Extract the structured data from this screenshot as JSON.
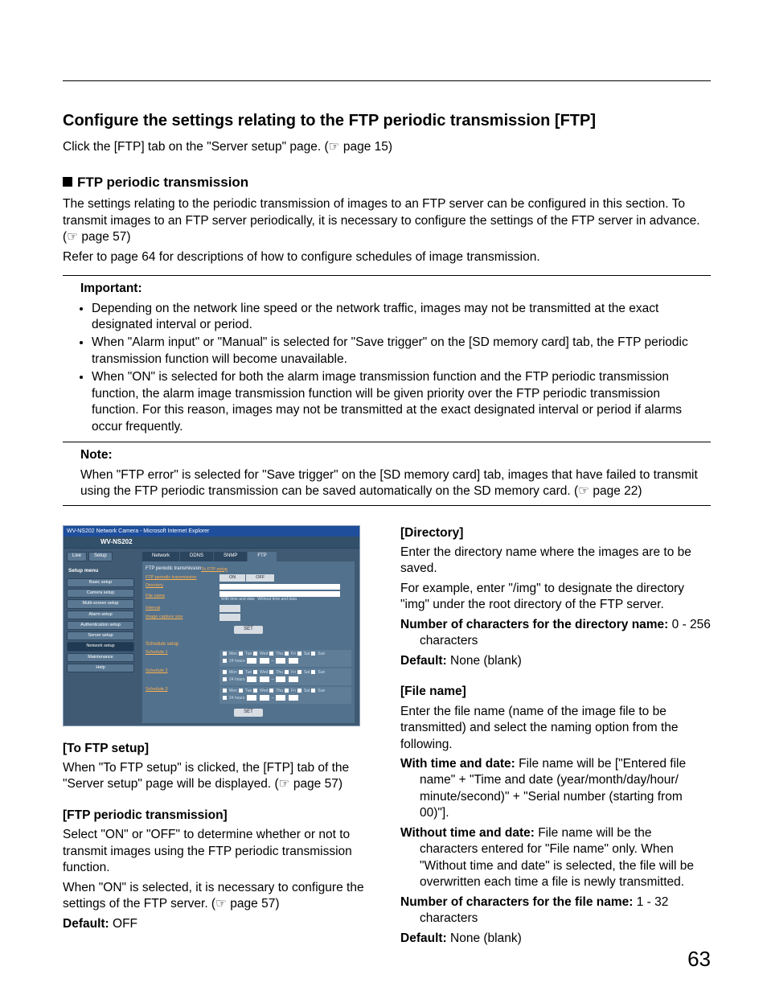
{
  "page_number": "63",
  "h1": "Configure the settings relating to the FTP periodic transmission [FTP]",
  "intro": "Click the [FTP] tab on the \"Server setup\" page. (☞ page 15)",
  "sub1": "FTP periodic transmission",
  "sub1_p1": "The settings relating to the periodic transmission of images to an FTP server can be configured in this section. To transmit images to an FTP server periodically, it is necessary to configure the settings of the FTP server in advance. (☞ page 57)",
  "sub1_p2": "Refer to page 64 for descriptions of how to configure schedules of image transmission.",
  "important": {
    "title": "Important:",
    "items": [
      "Depending on the network line speed or the network traffic, images may not be transmitted at the exact designated interval or period.",
      "When \"Alarm input\" or \"Manual\" is selected for \"Save trigger\" on the [SD memory card] tab, the FTP periodic transmission function will become unavailable.",
      "When \"ON\" is selected for both the alarm image transmission function and the FTP periodic transmission function, the alarm image transmission function will be given priority over the FTP periodic transmission function. For this reason, images may not be transmitted at the exact designated interval or period if alarms occur frequently."
    ]
  },
  "note": {
    "title": "Note:",
    "text": "When \"FTP error\" is selected for \"Save trigger\" on the [SD memory card] tab, images that have failed to transmit using the FTP periodic transmission can be saved automatically on the SD memory card. (☞ page 22)"
  },
  "screenshot": {
    "window_title": "WV-NS202 Network Camera - Microsoft Internet Explorer",
    "model": "WV-NS202",
    "top_tabs": {
      "live": "Live",
      "setup": "Setup"
    },
    "side_menu_title": "Setup menu",
    "side_menu": [
      "Basic setup",
      "Camera setup",
      "Multi-screen setup",
      "Alarm setup",
      "Authentication setup",
      "Server setup",
      "Network setup",
      "Maintenance",
      "Help"
    ],
    "main_tabs": [
      "Network",
      "DDNS",
      "SNMP",
      "FTP"
    ],
    "section_title": "FTP periodic transmission",
    "to_ftp_link": "To FTP setup",
    "rows": {
      "trans": "FTP periodic transmission",
      "on": "ON",
      "off": "OFF",
      "dir": "Directory",
      "file": "File name",
      "file_opt1": "With time and date",
      "file_opt2": "Without time and data",
      "interval": "Interval",
      "size": "Image capture size"
    },
    "set_btn": "SET",
    "sched_title": "Schedule setup",
    "schedules": [
      "Schedule 1",
      "Schedule 2",
      "Schedule 3"
    ],
    "days": [
      "Mon",
      "Tue",
      "Wed",
      "Thu",
      "Fri",
      "Sat",
      "Sun"
    ],
    "h24": "24 hours"
  },
  "left": {
    "s1_h": "[To FTP setup]",
    "s1_t": "When \"To FTP setup\" is clicked, the [FTP] tab of the \"Server setup\" page will be displayed. (☞ page 57)",
    "s2_h": "[FTP periodic transmission]",
    "s2_t1": "Select \"ON\" or \"OFF\" to determine whether or not to transmit images using the FTP periodic transmission function.",
    "s2_t2": "When \"ON\" is selected, it is necessary to configure the settings of the FTP server. (☞ page 57)",
    "s2_def_l": "Default:",
    "s2_def_v": " OFF"
  },
  "right": {
    "s1_h": "[Directory]",
    "s1_t1": "Enter the directory name where the images are to be saved.",
    "s1_t2": "For example, enter \"/img\" to designate the directory \"img\" under the root directory of the FTP server.",
    "s1_nc_l": "Number of characters for the directory name:",
    "s1_nc_v": " 0 - 256 characters",
    "s1_def_l": "Default:",
    "s1_def_v": " None (blank)",
    "s2_h": "[File name]",
    "s2_t": "Enter the file name (name of the image file to be transmitted) and select the naming option from the following.",
    "s2_a_l": "With time and date:",
    "s2_a_v": " File name will be [\"Entered file name\" + \"Time and date (year/month/day/hour/ minute/second)\" + \"Serial number (starting from 00)\"].",
    "s2_b_l": "Without time and date:",
    "s2_b_v": " File name will be the characters entered for \"File name\" only. When \"Without time and date\" is selected, the file will be overwritten each time a file is newly transmitted.",
    "s2_nc_l": "Number of characters for the file name:",
    "s2_nc_v": " 1 - 32 characters",
    "s2_def_l": "Default:",
    "s2_def_v": " None (blank)"
  }
}
